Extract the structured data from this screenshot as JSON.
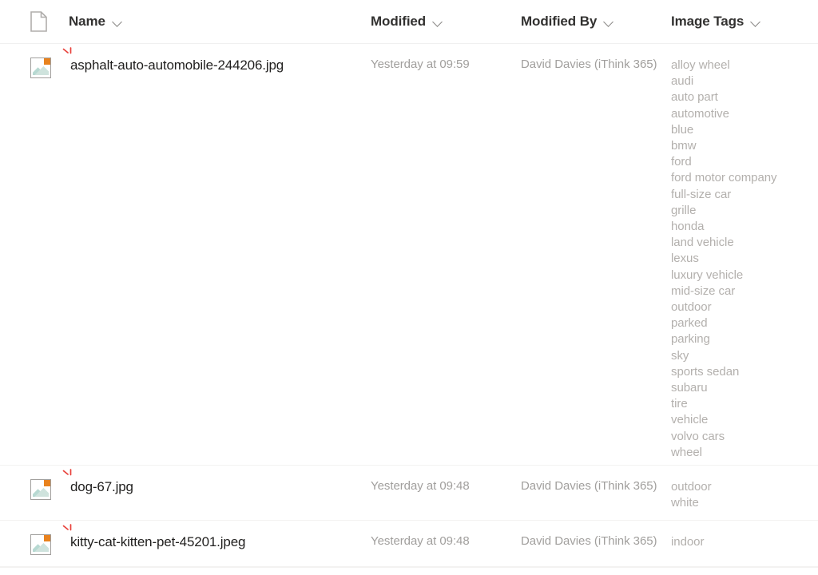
{
  "header": {
    "icon": "document-icon",
    "columns": [
      {
        "label": "Name",
        "sort_icon": "chevron-down-icon"
      },
      {
        "label": "Modified",
        "sort_icon": "chevron-down-icon"
      },
      {
        "label": "Modified By",
        "sort_icon": "chevron-down-icon"
      },
      {
        "label": "Image Tags",
        "sort_icon": "chevron-down-icon"
      }
    ]
  },
  "colors": {
    "text_primary": "#201f1e",
    "text_header": "#323130",
    "text_muted": "#a19f9d",
    "text_tag": "#b3b0ad",
    "divider": "#f3f2f1",
    "badge_orange": "#e8821e",
    "new_mark_red": "#e8403a",
    "icon_outline": "#a19f9d"
  },
  "rows": [
    {
      "icon": "picture-icon",
      "new_indicator": "new-sparkle-icon",
      "name": "asphalt-auto-automobile-244206.jpg",
      "modified": "Yesterday at 09:59",
      "modified_by": "David Davies (iThink 365)",
      "image_tags": [
        "alloy wheel",
        "audi",
        "auto part",
        "automotive",
        "blue",
        "bmw",
        "ford",
        "ford motor company",
        "full-size car",
        "grille",
        "honda",
        "land vehicle",
        "lexus",
        "luxury vehicle",
        "mid-size car",
        "outdoor",
        "parked",
        "parking",
        "sky",
        "sports sedan",
        "subaru",
        "tire",
        "vehicle",
        "volvo cars",
        "wheel"
      ]
    },
    {
      "icon": "picture-icon",
      "new_indicator": "new-sparkle-icon",
      "name": "dog-67.jpg",
      "modified": "Yesterday at 09:48",
      "modified_by": "David Davies (iThink 365)",
      "image_tags": [
        "outdoor",
        "white"
      ]
    },
    {
      "icon": "picture-icon",
      "new_indicator": "new-sparkle-icon",
      "name": "kitty-cat-kitten-pet-45201.jpeg",
      "modified": "Yesterday at 09:48",
      "modified_by": "David Davies (iThink 365)",
      "image_tags": [
        "indoor"
      ]
    }
  ]
}
